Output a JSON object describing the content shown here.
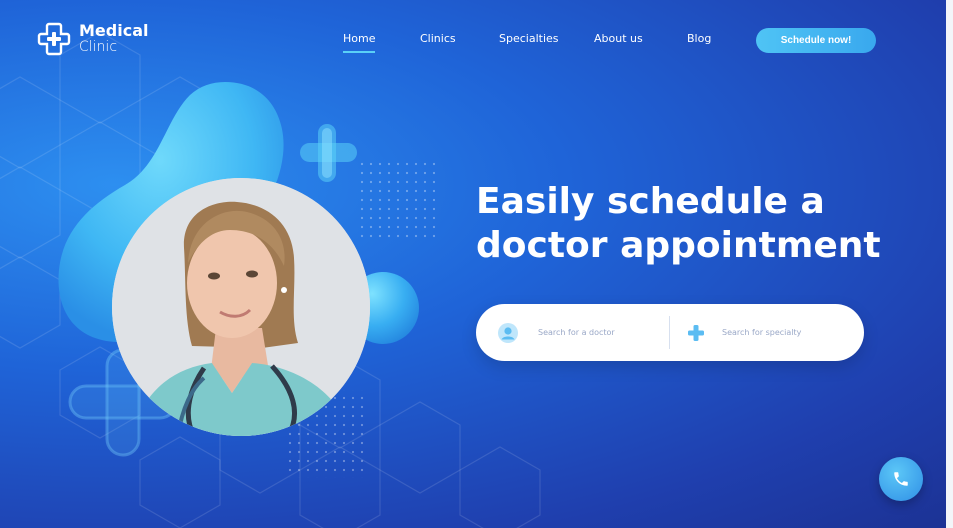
{
  "brand": {
    "title": "Medical",
    "subtitle": "Clinic",
    "icon": "medical-cross-logo-icon"
  },
  "nav": {
    "items": [
      {
        "label": "Home",
        "active": true
      },
      {
        "label": "Clinics",
        "active": false
      },
      {
        "label": "Specialties",
        "active": false
      },
      {
        "label": "About us",
        "active": false
      },
      {
        "label": "Blog",
        "active": false
      }
    ]
  },
  "cta": {
    "label": "Schedule now!"
  },
  "hero": {
    "headline_line1": "Easily schedule a",
    "headline_line2": "doctor appointment"
  },
  "search": {
    "doctor_placeholder": "Search for a doctor",
    "specialty_placeholder": "Search for specialty",
    "doctor_icon": "user-avatar-icon",
    "specialty_icon": "plus-cross-icon"
  },
  "call": {
    "icon": "phone-icon"
  },
  "colors": {
    "accent": "#4fc4f5",
    "background": "#1f4fc8",
    "cta": "#3faeef"
  }
}
